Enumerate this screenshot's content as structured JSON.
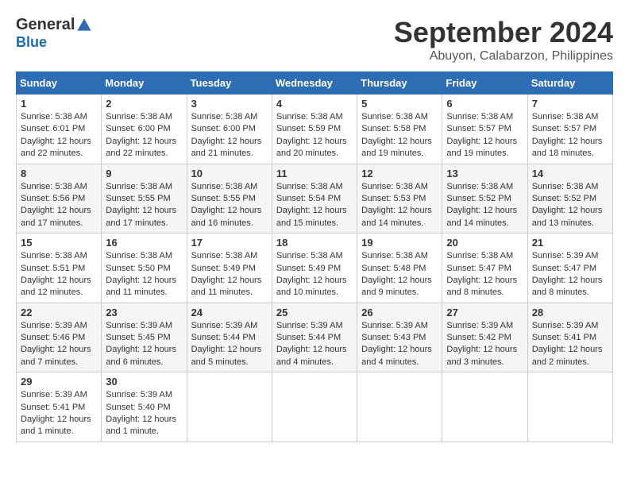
{
  "header": {
    "logo_general": "General",
    "logo_blue": "Blue",
    "month_title": "September 2024",
    "location": "Abuyon, Calabarzon, Philippines"
  },
  "weekdays": [
    "Sunday",
    "Monday",
    "Tuesday",
    "Wednesday",
    "Thursday",
    "Friday",
    "Saturday"
  ],
  "weeks": [
    [
      {
        "day": "1",
        "sunrise": "5:38 AM",
        "sunset": "6:01 PM",
        "daylight": "12 hours and 22 minutes."
      },
      {
        "day": "2",
        "sunrise": "5:38 AM",
        "sunset": "6:00 PM",
        "daylight": "12 hours and 22 minutes."
      },
      {
        "day": "3",
        "sunrise": "5:38 AM",
        "sunset": "6:00 PM",
        "daylight": "12 hours and 21 minutes."
      },
      {
        "day": "4",
        "sunrise": "5:38 AM",
        "sunset": "5:59 PM",
        "daylight": "12 hours and 20 minutes."
      },
      {
        "day": "5",
        "sunrise": "5:38 AM",
        "sunset": "5:58 PM",
        "daylight": "12 hours and 19 minutes."
      },
      {
        "day": "6",
        "sunrise": "5:38 AM",
        "sunset": "5:57 PM",
        "daylight": "12 hours and 19 minutes."
      },
      {
        "day": "7",
        "sunrise": "5:38 AM",
        "sunset": "5:57 PM",
        "daylight": "12 hours and 18 minutes."
      }
    ],
    [
      {
        "day": "8",
        "sunrise": "5:38 AM",
        "sunset": "5:56 PM",
        "daylight": "12 hours and 17 minutes."
      },
      {
        "day": "9",
        "sunrise": "5:38 AM",
        "sunset": "5:55 PM",
        "daylight": "12 hours and 17 minutes."
      },
      {
        "day": "10",
        "sunrise": "5:38 AM",
        "sunset": "5:55 PM",
        "daylight": "12 hours and 16 minutes."
      },
      {
        "day": "11",
        "sunrise": "5:38 AM",
        "sunset": "5:54 PM",
        "daylight": "12 hours and 15 minutes."
      },
      {
        "day": "12",
        "sunrise": "5:38 AM",
        "sunset": "5:53 PM",
        "daylight": "12 hours and 14 minutes."
      },
      {
        "day": "13",
        "sunrise": "5:38 AM",
        "sunset": "5:52 PM",
        "daylight": "12 hours and 14 minutes."
      },
      {
        "day": "14",
        "sunrise": "5:38 AM",
        "sunset": "5:52 PM",
        "daylight": "12 hours and 13 minutes."
      }
    ],
    [
      {
        "day": "15",
        "sunrise": "5:38 AM",
        "sunset": "5:51 PM",
        "daylight": "12 hours and 12 minutes."
      },
      {
        "day": "16",
        "sunrise": "5:38 AM",
        "sunset": "5:50 PM",
        "daylight": "12 hours and 11 minutes."
      },
      {
        "day": "17",
        "sunrise": "5:38 AM",
        "sunset": "5:49 PM",
        "daylight": "12 hours and 11 minutes."
      },
      {
        "day": "18",
        "sunrise": "5:38 AM",
        "sunset": "5:49 PM",
        "daylight": "12 hours and 10 minutes."
      },
      {
        "day": "19",
        "sunrise": "5:38 AM",
        "sunset": "5:48 PM",
        "daylight": "12 hours and 9 minutes."
      },
      {
        "day": "20",
        "sunrise": "5:38 AM",
        "sunset": "5:47 PM",
        "daylight": "12 hours and 8 minutes."
      },
      {
        "day": "21",
        "sunrise": "5:39 AM",
        "sunset": "5:47 PM",
        "daylight": "12 hours and 8 minutes."
      }
    ],
    [
      {
        "day": "22",
        "sunrise": "5:39 AM",
        "sunset": "5:46 PM",
        "daylight": "12 hours and 7 minutes."
      },
      {
        "day": "23",
        "sunrise": "5:39 AM",
        "sunset": "5:45 PM",
        "daylight": "12 hours and 6 minutes."
      },
      {
        "day": "24",
        "sunrise": "5:39 AM",
        "sunset": "5:44 PM",
        "daylight": "12 hours and 5 minutes."
      },
      {
        "day": "25",
        "sunrise": "5:39 AM",
        "sunset": "5:44 PM",
        "daylight": "12 hours and 4 minutes."
      },
      {
        "day": "26",
        "sunrise": "5:39 AM",
        "sunset": "5:43 PM",
        "daylight": "12 hours and 4 minutes."
      },
      {
        "day": "27",
        "sunrise": "5:39 AM",
        "sunset": "5:42 PM",
        "daylight": "12 hours and 3 minutes."
      },
      {
        "day": "28",
        "sunrise": "5:39 AM",
        "sunset": "5:41 PM",
        "daylight": "12 hours and 2 minutes."
      }
    ],
    [
      {
        "day": "29",
        "sunrise": "5:39 AM",
        "sunset": "5:41 PM",
        "daylight": "12 hours and 1 minute."
      },
      {
        "day": "30",
        "sunrise": "5:39 AM",
        "sunset": "5:40 PM",
        "daylight": "12 hours and 1 minute."
      },
      null,
      null,
      null,
      null,
      null
    ]
  ]
}
